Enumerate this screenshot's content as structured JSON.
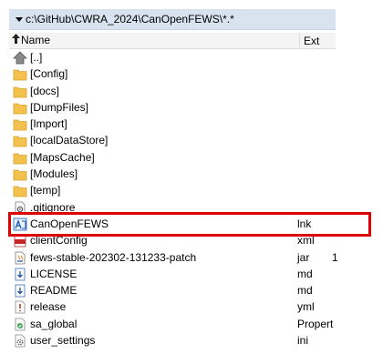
{
  "path": {
    "text": "c:\\GitHub\\CWRA_2024\\CanOpenFEWS\\*.*",
    "dropdown_icon": "chevron-down-icon"
  },
  "columns": {
    "name": "Name",
    "ext": "Ext",
    "sort_icon": "sort-up-arrow-icon"
  },
  "files": [
    {
      "name": "[..]",
      "ext": "",
      "icon": "parent-folder-icon"
    },
    {
      "name": "[Config]",
      "ext": "",
      "icon": "folder-icon"
    },
    {
      "name": "[docs]",
      "ext": "",
      "icon": "folder-icon"
    },
    {
      "name": "[DumpFiles]",
      "ext": "",
      "icon": "folder-icon"
    },
    {
      "name": "[Import]",
      "ext": "",
      "icon": "folder-icon"
    },
    {
      "name": "[localDataStore]",
      "ext": "",
      "icon": "folder-icon"
    },
    {
      "name": "[MapsCache]",
      "ext": "",
      "icon": "folder-icon"
    },
    {
      "name": "[Modules]",
      "ext": "",
      "icon": "folder-icon"
    },
    {
      "name": "[temp]",
      "ext": "",
      "icon": "folder-icon"
    },
    {
      "name": ".gitignore",
      "ext": "",
      "icon": "gear-file-icon"
    },
    {
      "name": "CanOpenFEWS",
      "ext": "lnk",
      "icon": "shortcut-icon"
    },
    {
      "name": "clientConfig",
      "ext": "xml",
      "icon": "xml-file-icon"
    },
    {
      "name": "fews-stable-202302-131233-patch",
      "ext": "jar",
      "icon": "jar-file-icon",
      "size": "1"
    },
    {
      "name": "LICENSE",
      "ext": "md",
      "icon": "markdown-file-icon"
    },
    {
      "name": "README",
      "ext": "md",
      "icon": "markdown-file-icon"
    },
    {
      "name": "release",
      "ext": "yml",
      "icon": "yml-file-icon"
    },
    {
      "name": "sa_global",
      "ext": "Propert",
      "icon": "properties-file-icon"
    },
    {
      "name": "user_settings",
      "ext": "ini",
      "icon": "ini-file-icon"
    }
  ],
  "colors": {
    "path_bar": "#d9e3ef",
    "folder": "#f2c14e",
    "highlight": "#e00000"
  }
}
